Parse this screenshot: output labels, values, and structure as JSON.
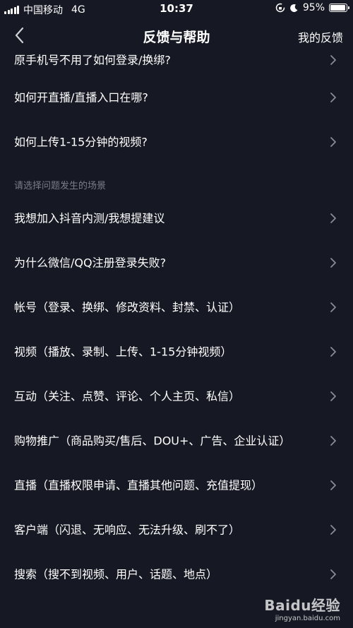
{
  "status_bar": {
    "carrier": "中国移动",
    "network": "4G",
    "time": "10:37",
    "battery_percent": "95%",
    "battery_level": 0.95,
    "icons": [
      "signal-icon",
      "moon-icon",
      "rotation-lock-icon",
      "battery-icon"
    ]
  },
  "nav": {
    "title": "反馈与帮助",
    "right_label": "我的反馈",
    "back_icon": "back-icon"
  },
  "faq_items": [
    {
      "label": "原手机号不用了如何登录/换绑?"
    },
    {
      "label": "如何开直播/直播入口在哪?"
    },
    {
      "label": "如何上传1-15分钟的视频?"
    }
  ],
  "section": {
    "title": "请选择问题发生的场景"
  },
  "scene_items": [
    {
      "label": "我想加入抖音内测/我想提建议"
    },
    {
      "label": "为什么微信/QQ注册登录失败?"
    },
    {
      "label": "帐号（登录、换绑、修改资料、封禁、认证）"
    },
    {
      "label": "视频（播放、录制、上传、1-15分钟视频）"
    },
    {
      "label": "互动（关注、点赞、评论、个人主页、私信）"
    },
    {
      "label": "购物推广（商品购买/售后、DOU+、广告、企业认证）"
    },
    {
      "label": "直播（直播权限申请、直播其他问题、充值提现）"
    },
    {
      "label": "客户端（闪退、无响应、无法升级、刷不了）"
    },
    {
      "label": "搜索（搜不到视频、用户、话题、地点）"
    }
  ],
  "watermark": {
    "brand": "Baidu经验",
    "url": "jingyan.baidu.com"
  },
  "colors": {
    "background": "#161823",
    "text": "#ffffff",
    "section_text": "#7b7d88",
    "chevron": "#8a8b93"
  }
}
